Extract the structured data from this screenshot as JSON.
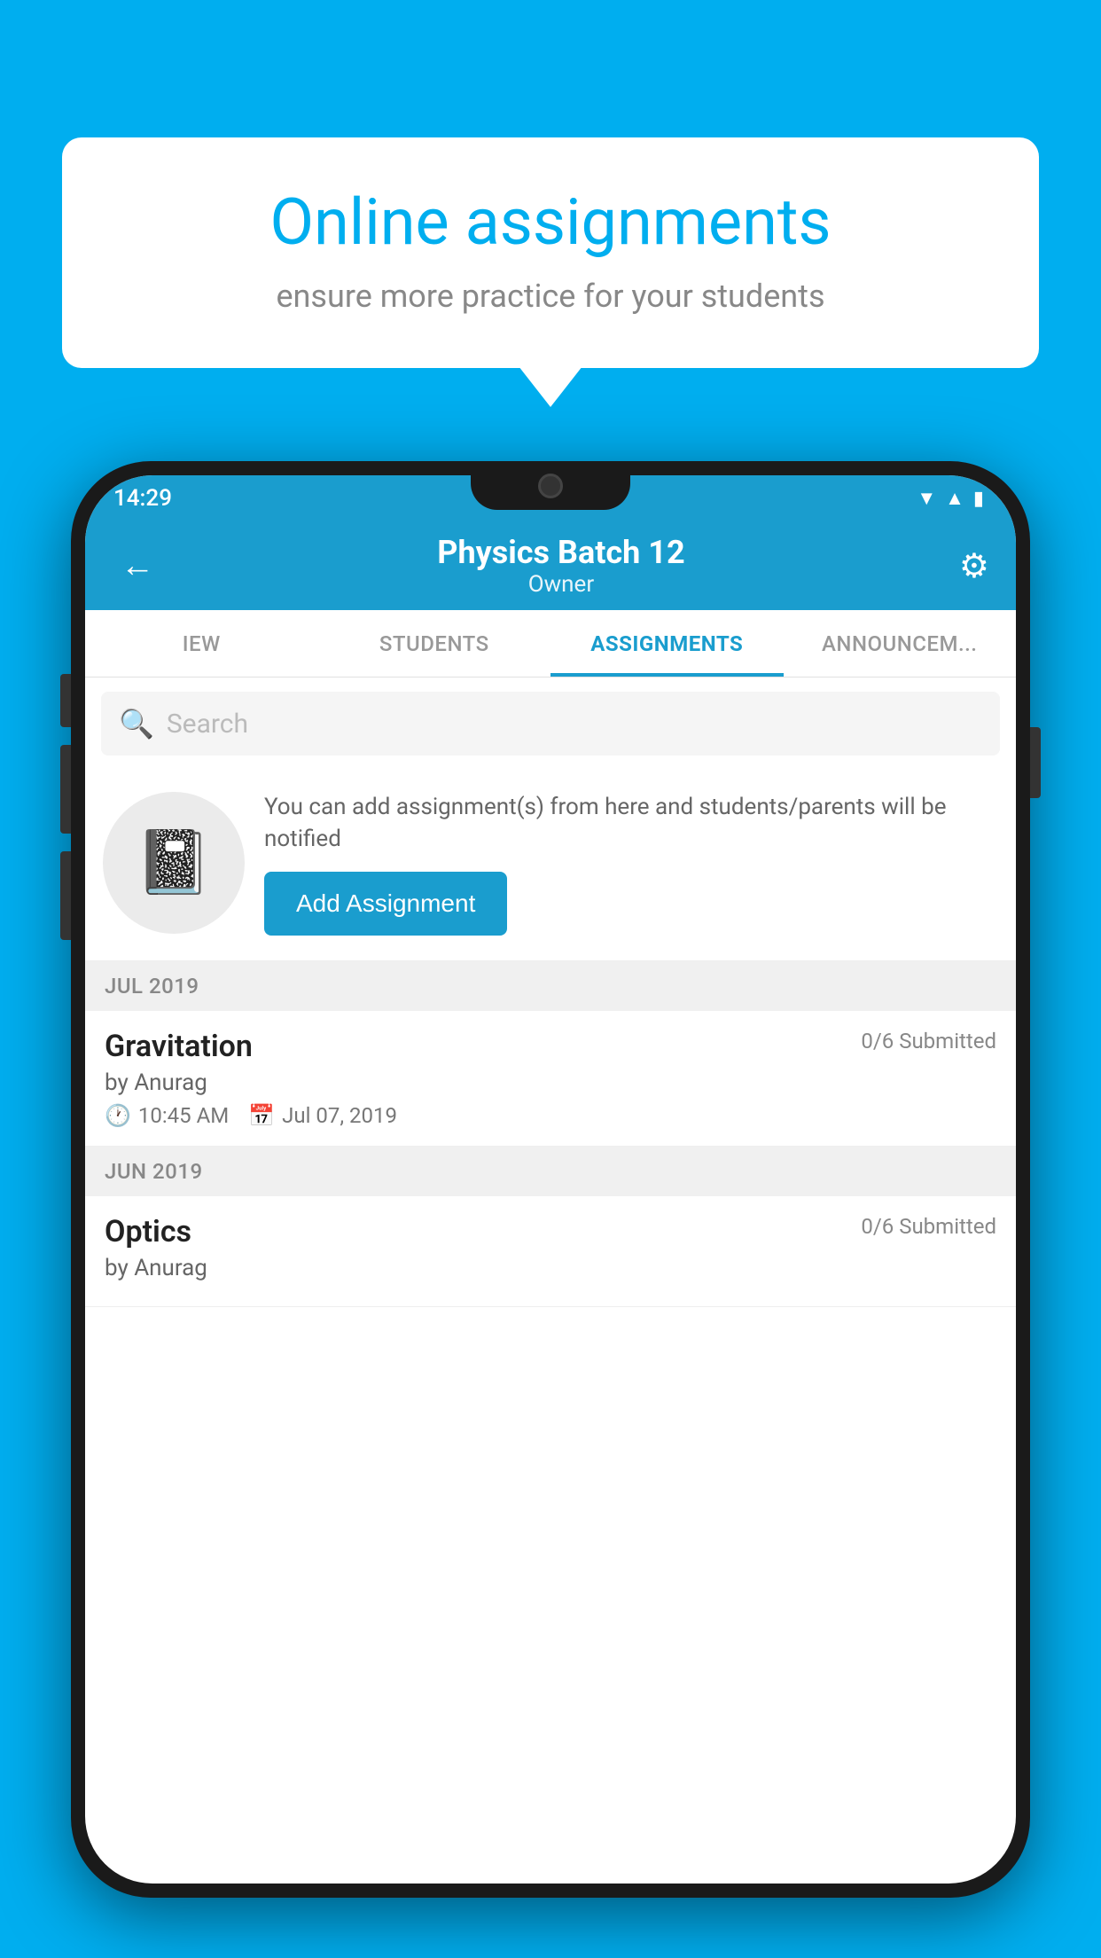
{
  "background_color": "#00AEEF",
  "bubble": {
    "title": "Online assignments",
    "subtitle": "ensure more practice for your students"
  },
  "status_bar": {
    "time": "14:29",
    "icons": [
      "wifi",
      "signal",
      "battery"
    ]
  },
  "top_bar": {
    "title": "Physics Batch 12",
    "subtitle": "Owner",
    "back_label": "←",
    "settings_label": "⚙"
  },
  "tabs": [
    {
      "label": "IEW",
      "active": false
    },
    {
      "label": "STUDENTS",
      "active": false
    },
    {
      "label": "ASSIGNMENTS",
      "active": true
    },
    {
      "label": "ANNOUNCEM...",
      "active": false
    }
  ],
  "search": {
    "placeholder": "Search"
  },
  "add_assignment": {
    "description": "You can add assignment(s) from here and students/parents will be notified",
    "button_label": "Add Assignment"
  },
  "sections": [
    {
      "header": "JUL 2019",
      "items": [
        {
          "title": "Gravitation",
          "submitted": "0/6 Submitted",
          "author": "by Anurag",
          "time": "10:45 AM",
          "date": "Jul 07, 2019"
        }
      ]
    },
    {
      "header": "JUN 2019",
      "items": [
        {
          "title": "Optics",
          "submitted": "0/6 Submitted",
          "author": "by Anurag",
          "time": "",
          "date": ""
        }
      ]
    }
  ]
}
